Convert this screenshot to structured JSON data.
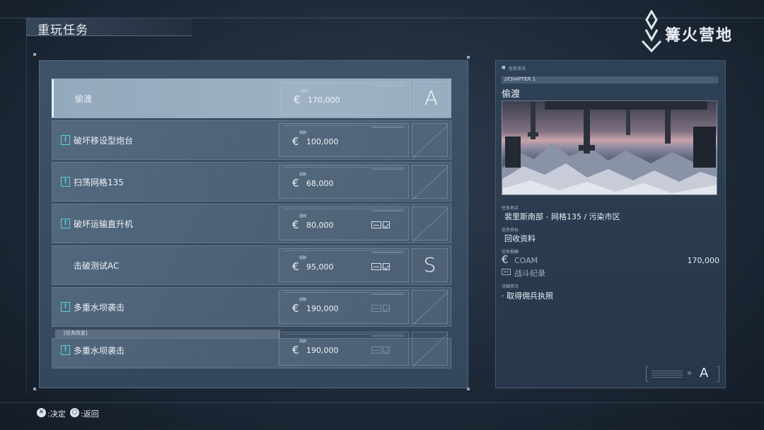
{
  "screen": {
    "title": "重玩任务"
  },
  "logo": {
    "text": "篝火营地"
  },
  "mission_list": {
    "reward_label": "报酬",
    "change_tag": "[任务改变]",
    "missions": [
      {
        "name": "偷渡",
        "reward": "170,000",
        "rank": "A",
        "alert": false,
        "selected": true,
        "battle_log": "none"
      },
      {
        "name": "破坏移设型炮台",
        "reward": "100,000",
        "rank": "",
        "alert": true,
        "selected": false,
        "battle_log": "none"
      },
      {
        "name": "扫荡网格135",
        "reward": "68,000",
        "rank": "",
        "alert": true,
        "selected": false,
        "battle_log": "none"
      },
      {
        "name": "破坏运输直升机",
        "reward": "80,000",
        "rank": "",
        "alert": true,
        "selected": false,
        "battle_log": "complete"
      },
      {
        "name": "击破测试AC",
        "reward": "95,000",
        "rank": "S",
        "alert": false,
        "selected": false,
        "battle_log": "complete"
      },
      {
        "name": "多重水坝袭击",
        "reward": "190,000",
        "rank": "",
        "alert": true,
        "selected": false,
        "battle_log": "incomplete"
      },
      {
        "name": "多重水坝袭击",
        "reward": "190,000",
        "rank": "",
        "alert": true,
        "selected": false,
        "battle_log": "incomplete"
      }
    ]
  },
  "detail": {
    "header_label": "任务资讯",
    "chapter": "//CHAPTER 1",
    "title": "偷渡",
    "location_label": "任务地点",
    "location": "裴里斯南部 - 网格135 / 污染市区",
    "objective_label": "任务目标",
    "objective": "回收资料",
    "reward_label": "任务报酬",
    "reward_currency": "COAM",
    "reward_amount": "170,000",
    "battle_log": "战斗纪录",
    "special_label": "详细资讯",
    "special": "· 取得佣兵执照",
    "footer_rank": "A"
  },
  "footer": {
    "confirm_button": "✕",
    "confirm_label": ":决定",
    "back_button": "○",
    "back_label": ":返回"
  },
  "colors": {
    "alert": "#59d3d4",
    "selected_row": "#9cb0c3",
    "panel": "#3f5368"
  }
}
